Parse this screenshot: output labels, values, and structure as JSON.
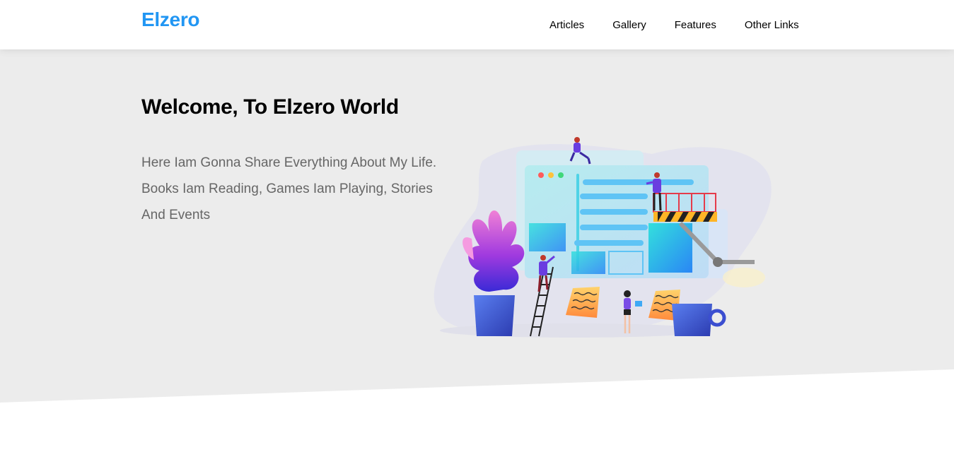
{
  "header": {
    "logo": "Elzero",
    "nav": [
      {
        "label": "Articles"
      },
      {
        "label": "Gallery"
      },
      {
        "label": "Features"
      },
      {
        "label": "Other Links"
      }
    ]
  },
  "landing": {
    "title": "Welcome, To Elzero World",
    "description": "Here Iam Gonna Share Everything About My Life. Books Iam Reading, Games Iam Playing, Stories And Events"
  },
  "colors": {
    "brand": "#2196f3",
    "landing_background": "#ececec",
    "text_muted": "#666666"
  }
}
